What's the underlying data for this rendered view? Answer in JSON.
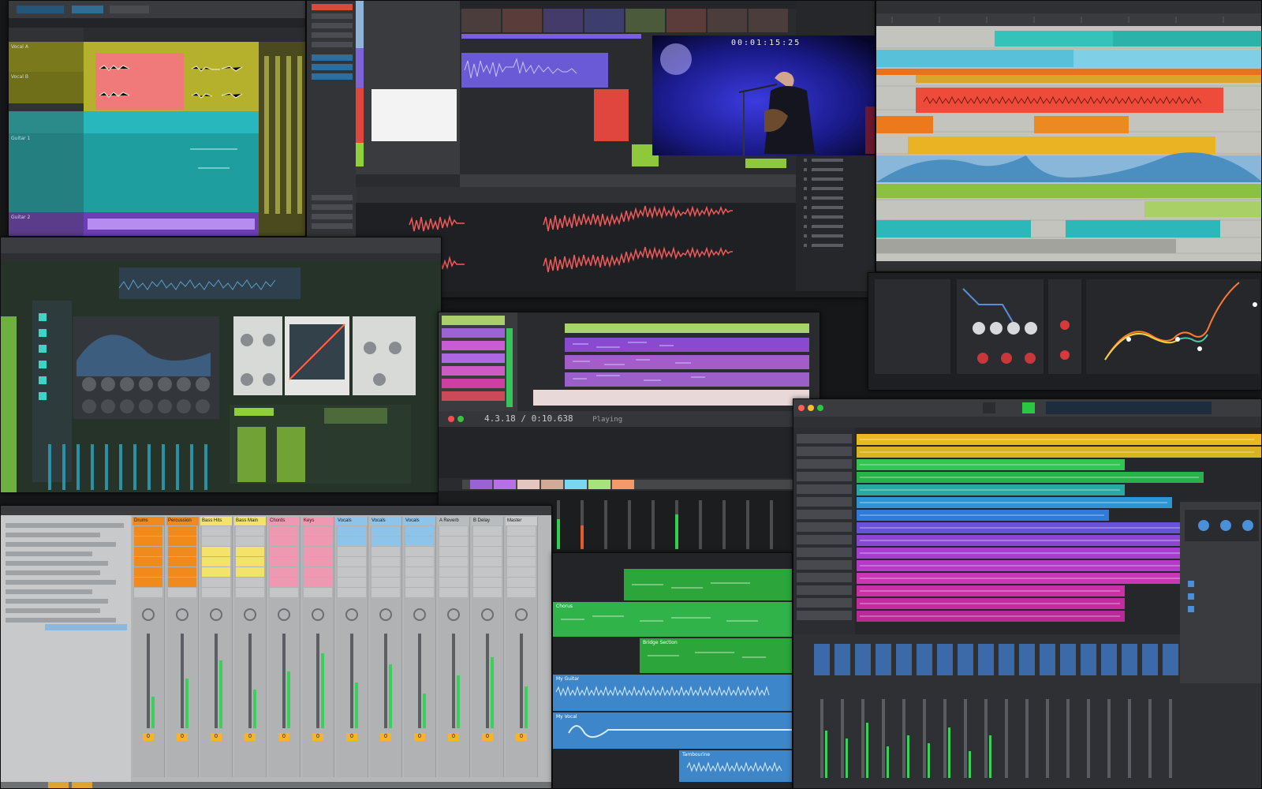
{
  "tracks_window": {
    "names": [
      "Vocal A",
      "Vocal B",
      "Guitar 1",
      "Guitar 2"
    ]
  },
  "video_window": {
    "timecode": "00:01:15:25"
  },
  "lower_mid_window": {
    "tempo_readout": "4.3.18 / 0:10.638",
    "state": "Playing"
  },
  "mixer_window": {
    "tracks": [
      "Drums",
      "Percussion",
      "Bass Hits",
      "Bass Main",
      "Chords",
      "Keys",
      "Vocals",
      "Vocals",
      "Vocals",
      "A Reverb",
      "B Delay",
      "Master"
    ],
    "track_colors": [
      "#f08a1c",
      "#f08a1c",
      "#f4e36a",
      "#f4e36a",
      "#ef98b2",
      "#ef98b2",
      "#8fc4ea",
      "#8fc4ea",
      "#8fc4ea",
      "#b9bcbe",
      "#b9bcbe",
      "#c9cbcd"
    ],
    "vol_labels": [
      "0",
      "0",
      "0",
      "0",
      "0",
      "0",
      "0",
      "0",
      "0",
      "0",
      "0",
      "0"
    ]
  },
  "arrange_window": {
    "regions": [
      "Chorus",
      "Bridge Section",
      "My Guitar",
      "My Vocal",
      "Tambourine"
    ]
  }
}
